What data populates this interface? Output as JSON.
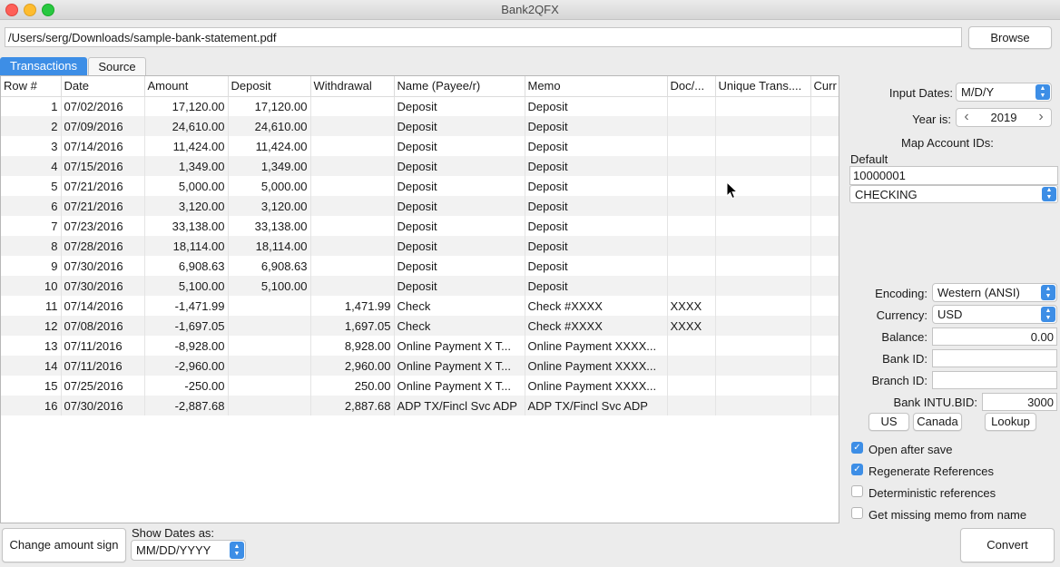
{
  "window": {
    "title": "Bank2QFX"
  },
  "path_field": {
    "value": "/Users/serg/Downloads/sample-bank-statement.pdf"
  },
  "browse_label": "Browse",
  "tabs": [
    {
      "label": "Transactions",
      "active": true
    },
    {
      "label": "Source",
      "active": false
    }
  ],
  "table": {
    "columns": [
      "Row #",
      "Date",
      "Amount",
      "Deposit",
      "Withdrawal",
      "Name (Payee/r)",
      "Memo",
      "Doc/...",
      "Unique Trans....",
      "Curr"
    ],
    "rows": [
      [
        "1",
        "07/02/2016",
        "17,120.00",
        "17,120.00",
        "",
        "Deposit",
        "Deposit",
        "",
        "",
        ""
      ],
      [
        "2",
        "07/09/2016",
        "24,610.00",
        "24,610.00",
        "",
        "Deposit",
        "Deposit",
        "",
        "",
        ""
      ],
      [
        "3",
        "07/14/2016",
        "11,424.00",
        "11,424.00",
        "",
        "Deposit",
        "Deposit",
        "",
        "",
        ""
      ],
      [
        "4",
        "07/15/2016",
        "1,349.00",
        "1,349.00",
        "",
        "Deposit",
        "Deposit",
        "",
        "",
        ""
      ],
      [
        "5",
        "07/21/2016",
        "5,000.00",
        "5,000.00",
        "",
        "Deposit",
        "Deposit",
        "",
        "",
        ""
      ],
      [
        "6",
        "07/21/2016",
        "3,120.00",
        "3,120.00",
        "",
        "Deposit",
        "Deposit",
        "",
        "",
        ""
      ],
      [
        "7",
        "07/23/2016",
        "33,138.00",
        "33,138.00",
        "",
        "Deposit",
        "Deposit",
        "",
        "",
        ""
      ],
      [
        "8",
        "07/28/2016",
        "18,114.00",
        "18,114.00",
        "",
        "Deposit",
        "Deposit",
        "",
        "",
        ""
      ],
      [
        "9",
        "07/30/2016",
        "6,908.63",
        "6,908.63",
        "",
        "Deposit",
        "Deposit",
        "",
        "",
        ""
      ],
      [
        "10",
        "07/30/2016",
        "5,100.00",
        "5,100.00",
        "",
        "Deposit",
        "Deposit",
        "",
        "",
        ""
      ],
      [
        "11",
        "07/14/2016",
        "-1,471.99",
        "",
        "1,471.99",
        "Check",
        "Check #XXXX",
        "XXXX",
        "",
        ""
      ],
      [
        "12",
        "07/08/2016",
        "-1,697.05",
        "",
        "1,697.05",
        "Check",
        "Check #XXXX",
        "XXXX",
        "",
        ""
      ],
      [
        "13",
        "07/11/2016",
        "-8,928.00",
        "",
        "8,928.00",
        "Online Payment X T...",
        "Online Payment XXXX...",
        "",
        "",
        ""
      ],
      [
        "14",
        "07/11/2016",
        "-2,960.00",
        "",
        "2,960.00",
        "Online Payment X T...",
        "Online Payment XXXX...",
        "",
        "",
        ""
      ],
      [
        "15",
        "07/25/2016",
        "-250.00",
        "",
        "250.00",
        "Online Payment X T...",
        "Online Payment XXXX...",
        "",
        "",
        ""
      ],
      [
        "16",
        "07/30/2016",
        "-2,887.68",
        "",
        "2,887.68",
        "ADP TX/Fincl Svc ADP",
        "ADP TX/Fincl Svc ADP",
        "",
        "",
        ""
      ]
    ]
  },
  "right_panel": {
    "input_dates_label": "Input Dates:",
    "input_dates_value": "M/D/Y",
    "year_label": "Year is:",
    "year_value": "2019",
    "map_accounts_label": "Map Account IDs:",
    "default_label": "Default",
    "account_id": "10000001",
    "account_type": "CHECKING",
    "encoding_label": "Encoding:",
    "encoding_value": "Western (ANSI)",
    "currency_label": "Currency:",
    "currency_value": "USD",
    "balance_label": "Balance:",
    "balance_value": "0.00",
    "bank_id_label": "Bank ID:",
    "bank_id_value": "",
    "branch_id_label": "Branch ID:",
    "branch_id_value": "",
    "intu_bid_label": "Bank INTU.BID:",
    "intu_bid_value": "3000",
    "us_label": "US",
    "canada_label": "Canada",
    "lookup_label": "Lookup",
    "checkboxes": [
      {
        "label": "Open after save",
        "checked": true
      },
      {
        "label": "Regenerate References",
        "checked": true
      },
      {
        "label": "Deterministic references",
        "checked": false
      },
      {
        "label": "Get missing memo from name",
        "checked": false
      }
    ]
  },
  "bottom": {
    "change_sign_label": "Change amount sign",
    "show_dates_label": "Show Dates as:",
    "show_dates_value": "MM/DD/YYYY",
    "convert_label": "Convert"
  },
  "colors": {
    "accent": "#3d8ee6",
    "row_alt": "#f2f2f2"
  },
  "icons": [
    "close-window-icon",
    "minimize-window-icon",
    "zoom-window-icon",
    "select-arrows-icon",
    "chevron-left-icon",
    "chevron-right-icon",
    "checkmark-icon",
    "mouse-pointer-icon"
  ]
}
